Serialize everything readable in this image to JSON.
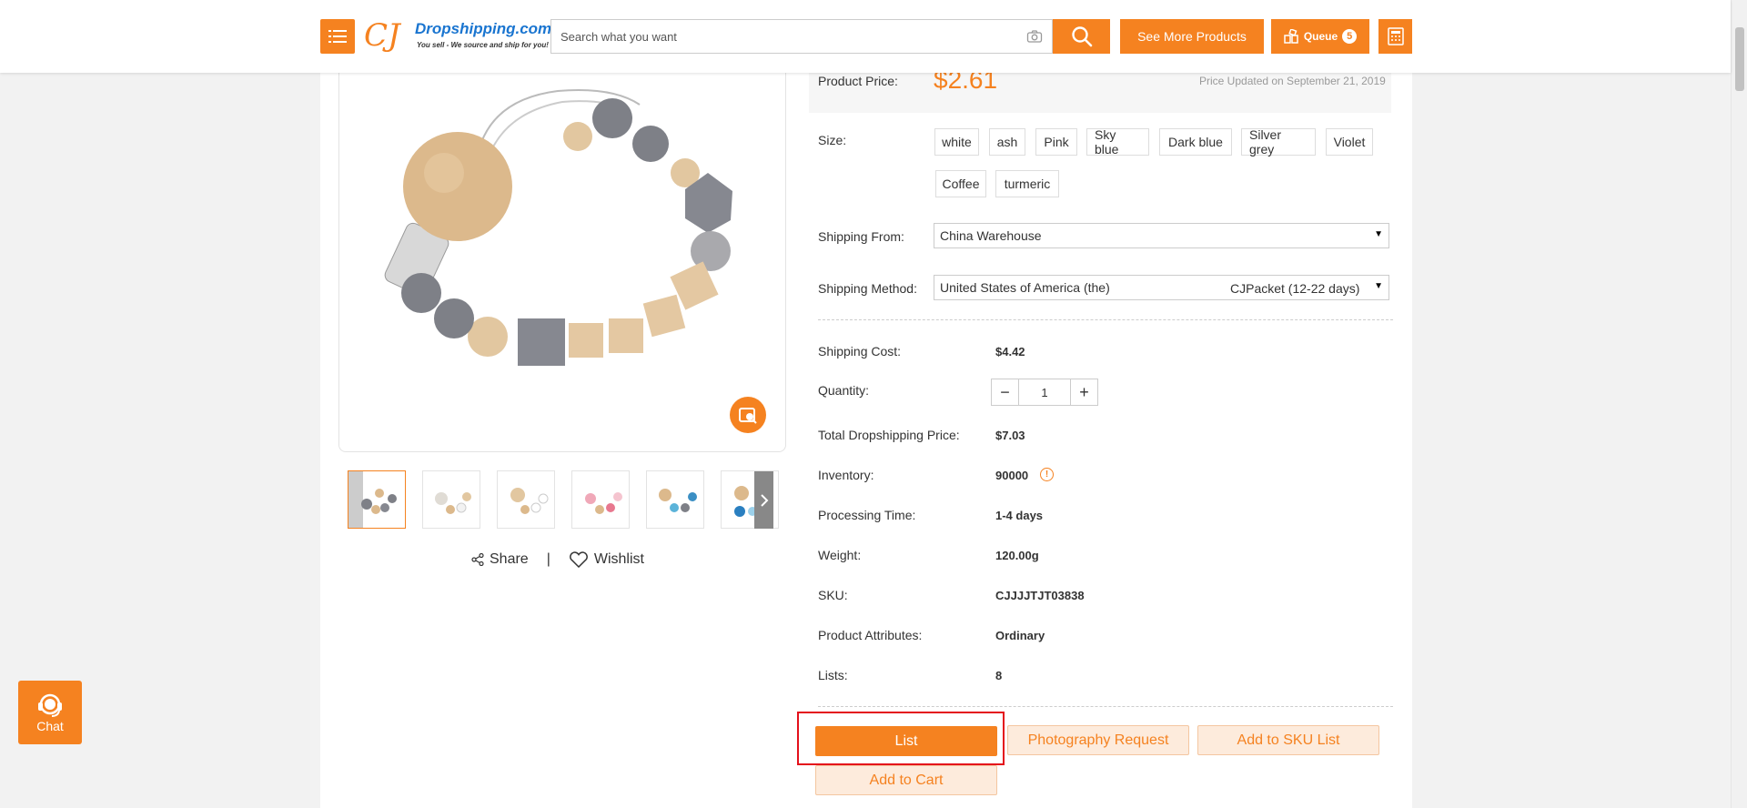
{
  "header": {
    "logo_mark": "CJ",
    "logo_brand": "Dropshipping.com",
    "logo_tagline": "You sell - We source and ship for you!",
    "search_placeholder": "Search what you want",
    "see_more_label": "See More Products",
    "queue_label": "Queue",
    "queue_count": "5",
    "icons": [
      "menu-icon",
      "camera-icon",
      "search-icon",
      "queue-icon",
      "calculator-icon"
    ]
  },
  "gallery": {
    "thumbnail_count": 6,
    "active_thumbnail": 0,
    "share_label": "Share",
    "separator": "|",
    "wishlist_label": "Wishlist"
  },
  "product": {
    "price_label": "Product Price:",
    "price": "$2.61",
    "price_updated": "Price Updated on September 21, 2019",
    "size_label": "Size:",
    "sizes": [
      "white",
      "ash",
      "Pink",
      "Sky blue",
      "Dark blue",
      "Silver grey",
      "Violet",
      "Coffee",
      "turmeric"
    ],
    "shipping_from_label": "Shipping From:",
    "shipping_from_value": "China Warehouse",
    "shipping_method_label": "Shipping Method:",
    "shipping_country": "United States of America (the)",
    "shipping_method_value": "CJPacket (12-22 days)",
    "shipping_cost_label": "Shipping Cost:",
    "shipping_cost": "$4.42",
    "quantity_label": "Quantity:",
    "quantity": "1",
    "total_label": "Total Dropshipping Price:",
    "total": "$7.03",
    "inventory_label": "Inventory:",
    "inventory": "90000",
    "processing_label": "Processing Time:",
    "processing": "1-4 days",
    "weight_label": "Weight:",
    "weight": "120.00g",
    "sku_label": "SKU:",
    "sku": "CJJJJTJT03838",
    "attributes_label": "Product Attributes:",
    "attributes": "Ordinary",
    "lists_label": "Lists:",
    "lists": "8"
  },
  "actions": {
    "list_label": "List",
    "photography_label": "Photography Request",
    "add_sku_label": "Add to SKU List",
    "add_cart_label": "Add to Cart"
  },
  "chat": {
    "label": "Chat"
  },
  "colors": {
    "accent": "#f58220",
    "highlight": "#e4101b",
    "logo_blue": "#1a75d0"
  }
}
